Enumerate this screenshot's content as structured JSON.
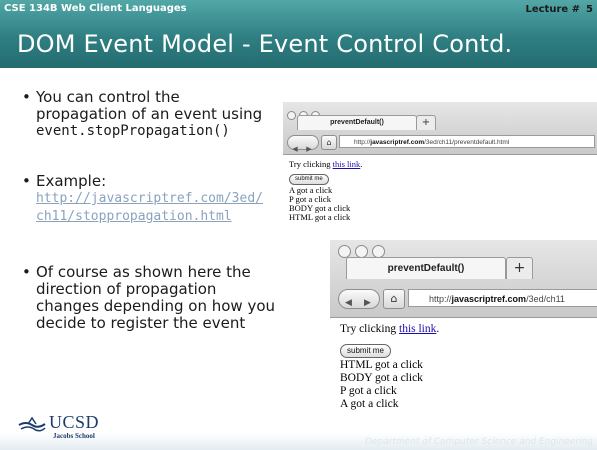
{
  "header": {
    "course": "CSE 134B  Web Client Languages",
    "lecture_label": "Lecture #",
    "lecture_number": "5",
    "title": "DOM Event Model - Event Control Contd."
  },
  "bullets": [
    {
      "line1": "You can control the",
      "line2": "propagation of an event using",
      "code": "event.stopPropagation()"
    },
    {
      "label": "Example:",
      "link_line1": "http://javascriptref.com/3ed/",
      "link_line2": "ch11/stoppropagation.html"
    },
    {
      "line1": "Of course as shown here the",
      "line2": "direction of propagation",
      "line3": "changes depending on how you",
      "line4": "decide to register the event"
    }
  ],
  "browser1": {
    "tab_title": "preventDefault()",
    "plus": "+",
    "back": "◀",
    "forward": "▶",
    "home": "⌂",
    "url_prefix": "http://",
    "url_domain": "javascriptref.com",
    "url_path": "/3ed/ch11/preventdefault.html",
    "text_before_link": "Try clicking ",
    "link_text": "this link",
    "text_after_link": ".",
    "button_label": "submit me",
    "log": [
      "A got a click",
      "P got a click",
      "BODY got a click",
      "HTML got a click"
    ]
  },
  "browser2": {
    "tab_title": "preventDefault()",
    "plus": "+",
    "back": "◀",
    "forward": "▶",
    "home": "⌂",
    "url_prefix": "http://",
    "url_domain": "javascriptref.com",
    "url_path": "/3ed/ch11",
    "text_before_link": "Try clicking ",
    "link_text": "this link",
    "text_after_link": ".",
    "button_label": "submit me",
    "log": [
      "HTML got a click",
      "BODY got a click",
      "P got a click",
      "A got a click"
    ]
  },
  "footer": {
    "logo_text": "UCSD",
    "logo_subtext": "Jacobs School",
    "department": "Department of Computer Science and Engineering"
  },
  "colors": {
    "header_teal": "#2f7f82",
    "link": "#8aa3bd",
    "logo_navy": "#1d3c6d"
  }
}
